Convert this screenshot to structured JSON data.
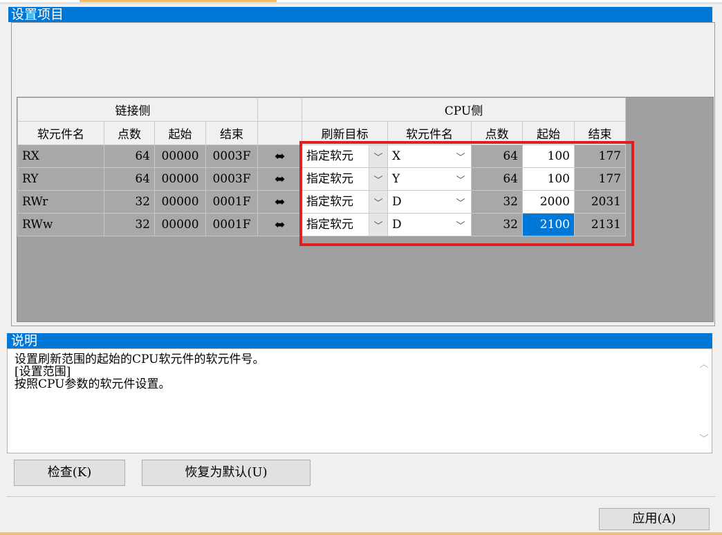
{
  "section_title": "设置项目",
  "description_title": "说明",
  "table": {
    "group_link": "链接侧",
    "group_cpu": "CPU侧",
    "col_headers": [
      "软元件名",
      "点数",
      "起始",
      "结束",
      "刷新目标",
      "软元件名",
      "点数",
      "起始",
      "结束"
    ],
    "rows": [
      {
        "name": "RX",
        "points": "64",
        "start": "00000",
        "end": "0003F",
        "target": "指定软元",
        "device": "X",
        "cpu_points": "64",
        "cpu_start": "100",
        "cpu_end": "177"
      },
      {
        "name": "RY",
        "points": "64",
        "start": "00000",
        "end": "0003F",
        "target": "指定软元",
        "device": "Y",
        "cpu_points": "64",
        "cpu_start": "100",
        "cpu_end": "177"
      },
      {
        "name": "RWr",
        "points": "32",
        "start": "00000",
        "end": "0001F",
        "target": "指定软元",
        "device": "D",
        "cpu_points": "32",
        "cpu_start": "2000",
        "cpu_end": "2031"
      },
      {
        "name": "RWw",
        "points": "32",
        "start": "00000",
        "end": "0001F",
        "target": "指定软元",
        "device": "D",
        "cpu_points": "32",
        "cpu_start": "2100",
        "cpu_end": "2131"
      }
    ],
    "arrow_icon": "double-arrow-icon",
    "dropdown_icon": "chevron-down-icon"
  },
  "description": {
    "lines": [
      "设置刷新范围的起始的CPU软元件的软元件号。",
      "[设置范围]",
      "按照CPU参数的软元件设置。"
    ]
  },
  "buttons": {
    "check": "检查(K)",
    "reset": "恢复为默认(U)",
    "apply": "应用(A)"
  },
  "colors": {
    "header_blue": "#0078d7",
    "highlight_red": "#e02020",
    "selected_cell": "#0078d7"
  }
}
